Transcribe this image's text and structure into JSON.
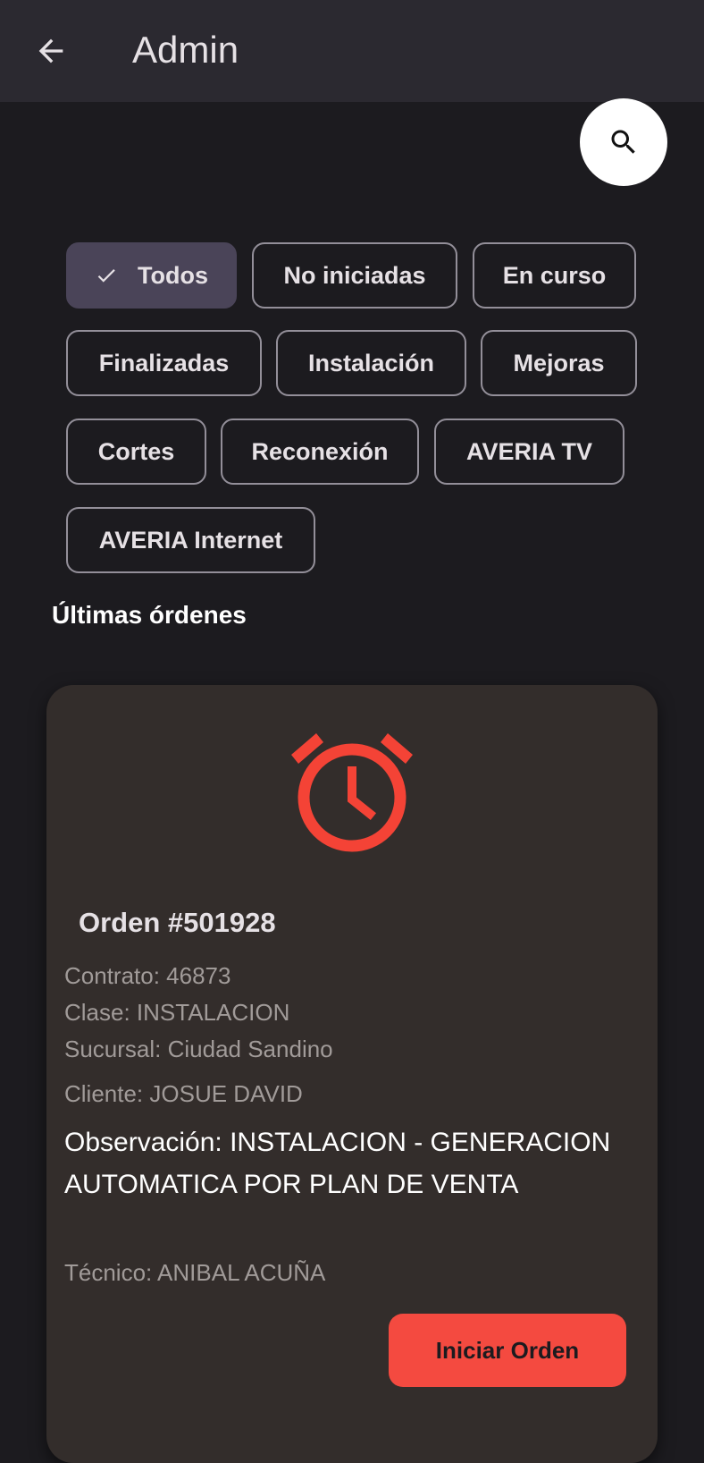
{
  "app_bar": {
    "title": "Admin",
    "back_icon": "arrow-back-icon"
  },
  "search": {
    "icon": "search-icon"
  },
  "filters": {
    "selected": "Todos",
    "chips": [
      "Todos",
      "No iniciadas",
      "En curso",
      "Finalizadas",
      "Instalación",
      "Mejoras",
      "Cortes",
      "Reconexión",
      "AVERIA TV",
      "AVERIA Internet"
    ]
  },
  "section": {
    "title": "Últimas órdenes"
  },
  "order": {
    "status_icon": "alarm-clock-icon",
    "status_color": "#f44336",
    "title": "Orden #501928",
    "contrato": "Contrato: 46873",
    "clase": "Clase: INSTALACION",
    "sucursal": "Sucursal: Ciudad Sandino",
    "cliente": "Cliente: JOSUE DAVID",
    "observacion": "Observación: INSTALACION - GENERACION AUTOMATICA POR PLAN DE VENTA",
    "tecnico": "Técnico: ANIBAL ACUÑA",
    "action_label": "Iniciar Orden"
  },
  "colors": {
    "background": "#1c1b1f",
    "app_bar": "#2b2930",
    "card": "#332d2b",
    "accent": "#f44a40",
    "chip_selected": "#4a4458"
  }
}
